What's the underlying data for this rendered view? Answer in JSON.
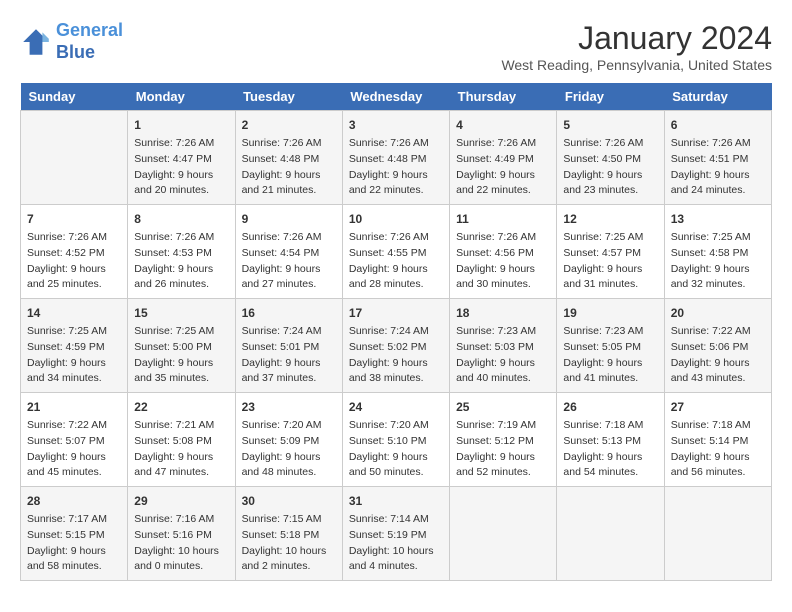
{
  "app": {
    "name": "GeneralBlue",
    "logo_letter1": "General",
    "logo_letter2": "Blue"
  },
  "title": "January 2024",
  "subtitle": "West Reading, Pennsylvania, United States",
  "days_of_week": [
    "Sunday",
    "Monday",
    "Tuesday",
    "Wednesday",
    "Thursday",
    "Friday",
    "Saturday"
  ],
  "weeks": [
    [
      {
        "day": "",
        "info": ""
      },
      {
        "day": "1",
        "info": "Sunrise: 7:26 AM\nSunset: 4:47 PM\nDaylight: 9 hours\nand 20 minutes."
      },
      {
        "day": "2",
        "info": "Sunrise: 7:26 AM\nSunset: 4:48 PM\nDaylight: 9 hours\nand 21 minutes."
      },
      {
        "day": "3",
        "info": "Sunrise: 7:26 AM\nSunset: 4:48 PM\nDaylight: 9 hours\nand 22 minutes."
      },
      {
        "day": "4",
        "info": "Sunrise: 7:26 AM\nSunset: 4:49 PM\nDaylight: 9 hours\nand 22 minutes."
      },
      {
        "day": "5",
        "info": "Sunrise: 7:26 AM\nSunset: 4:50 PM\nDaylight: 9 hours\nand 23 minutes."
      },
      {
        "day": "6",
        "info": "Sunrise: 7:26 AM\nSunset: 4:51 PM\nDaylight: 9 hours\nand 24 minutes."
      }
    ],
    [
      {
        "day": "7",
        "info": "Sunrise: 7:26 AM\nSunset: 4:52 PM\nDaylight: 9 hours\nand 25 minutes."
      },
      {
        "day": "8",
        "info": "Sunrise: 7:26 AM\nSunset: 4:53 PM\nDaylight: 9 hours\nand 26 minutes."
      },
      {
        "day": "9",
        "info": "Sunrise: 7:26 AM\nSunset: 4:54 PM\nDaylight: 9 hours\nand 27 minutes."
      },
      {
        "day": "10",
        "info": "Sunrise: 7:26 AM\nSunset: 4:55 PM\nDaylight: 9 hours\nand 28 minutes."
      },
      {
        "day": "11",
        "info": "Sunrise: 7:26 AM\nSunset: 4:56 PM\nDaylight: 9 hours\nand 30 minutes."
      },
      {
        "day": "12",
        "info": "Sunrise: 7:25 AM\nSunset: 4:57 PM\nDaylight: 9 hours\nand 31 minutes."
      },
      {
        "day": "13",
        "info": "Sunrise: 7:25 AM\nSunset: 4:58 PM\nDaylight: 9 hours\nand 32 minutes."
      }
    ],
    [
      {
        "day": "14",
        "info": "Sunrise: 7:25 AM\nSunset: 4:59 PM\nDaylight: 9 hours\nand 34 minutes."
      },
      {
        "day": "15",
        "info": "Sunrise: 7:25 AM\nSunset: 5:00 PM\nDaylight: 9 hours\nand 35 minutes."
      },
      {
        "day": "16",
        "info": "Sunrise: 7:24 AM\nSunset: 5:01 PM\nDaylight: 9 hours\nand 37 minutes."
      },
      {
        "day": "17",
        "info": "Sunrise: 7:24 AM\nSunset: 5:02 PM\nDaylight: 9 hours\nand 38 minutes."
      },
      {
        "day": "18",
        "info": "Sunrise: 7:23 AM\nSunset: 5:03 PM\nDaylight: 9 hours\nand 40 minutes."
      },
      {
        "day": "19",
        "info": "Sunrise: 7:23 AM\nSunset: 5:05 PM\nDaylight: 9 hours\nand 41 minutes."
      },
      {
        "day": "20",
        "info": "Sunrise: 7:22 AM\nSunset: 5:06 PM\nDaylight: 9 hours\nand 43 minutes."
      }
    ],
    [
      {
        "day": "21",
        "info": "Sunrise: 7:22 AM\nSunset: 5:07 PM\nDaylight: 9 hours\nand 45 minutes."
      },
      {
        "day": "22",
        "info": "Sunrise: 7:21 AM\nSunset: 5:08 PM\nDaylight: 9 hours\nand 47 minutes."
      },
      {
        "day": "23",
        "info": "Sunrise: 7:20 AM\nSunset: 5:09 PM\nDaylight: 9 hours\nand 48 minutes."
      },
      {
        "day": "24",
        "info": "Sunrise: 7:20 AM\nSunset: 5:10 PM\nDaylight: 9 hours\nand 50 minutes."
      },
      {
        "day": "25",
        "info": "Sunrise: 7:19 AM\nSunset: 5:12 PM\nDaylight: 9 hours\nand 52 minutes."
      },
      {
        "day": "26",
        "info": "Sunrise: 7:18 AM\nSunset: 5:13 PM\nDaylight: 9 hours\nand 54 minutes."
      },
      {
        "day": "27",
        "info": "Sunrise: 7:18 AM\nSunset: 5:14 PM\nDaylight: 9 hours\nand 56 minutes."
      }
    ],
    [
      {
        "day": "28",
        "info": "Sunrise: 7:17 AM\nSunset: 5:15 PM\nDaylight: 9 hours\nand 58 minutes."
      },
      {
        "day": "29",
        "info": "Sunrise: 7:16 AM\nSunset: 5:16 PM\nDaylight: 10 hours\nand 0 minutes."
      },
      {
        "day": "30",
        "info": "Sunrise: 7:15 AM\nSunset: 5:18 PM\nDaylight: 10 hours\nand 2 minutes."
      },
      {
        "day": "31",
        "info": "Sunrise: 7:14 AM\nSunset: 5:19 PM\nDaylight: 10 hours\nand 4 minutes."
      },
      {
        "day": "",
        "info": ""
      },
      {
        "day": "",
        "info": ""
      },
      {
        "day": "",
        "info": ""
      }
    ]
  ]
}
